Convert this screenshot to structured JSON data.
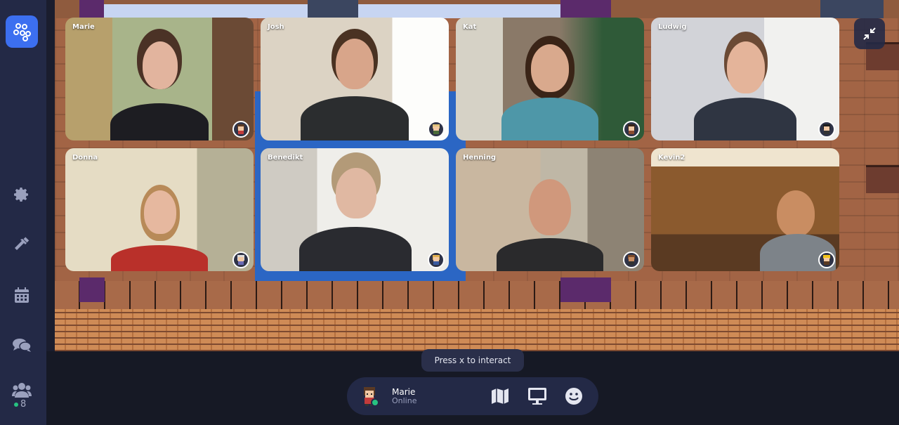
{
  "sidebar": {
    "online_count": "8"
  },
  "tiles": [
    {
      "name": "Marie"
    },
    {
      "name": "Josh"
    },
    {
      "name": "Kat"
    },
    {
      "name": "Ludwig"
    },
    {
      "name": "Donna"
    },
    {
      "name": "Benedikt"
    },
    {
      "name": "Henning"
    },
    {
      "name": "Kevin2"
    }
  ],
  "tooltip": "Press x to interact",
  "player": {
    "name": "Marie",
    "status": "Online"
  },
  "colors": {
    "accent": "#3c6ff0",
    "sidebar": "#232946",
    "online": "#27c281"
  },
  "icons": [
    "logo-icon",
    "settings-icon",
    "build-hammer-icon",
    "calendar-icon",
    "chat-icon",
    "participants-icon",
    "collapse-icon",
    "map-icon",
    "screen-share-icon",
    "emoji-icon"
  ]
}
